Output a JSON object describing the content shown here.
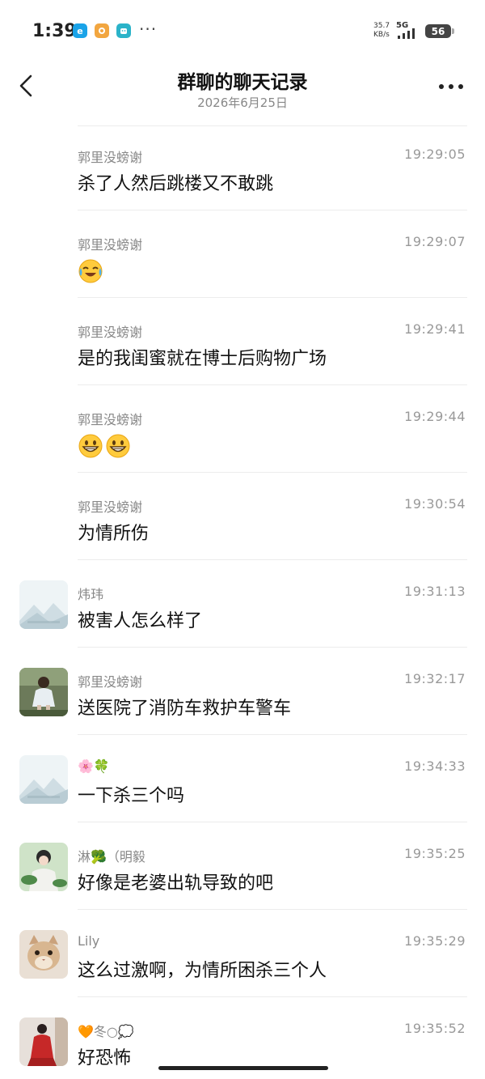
{
  "status": {
    "time": "1:39",
    "more": "···",
    "net_speed_top": "35.7",
    "net_speed_bottom": "KB/s",
    "network": "5G",
    "battery": "56"
  },
  "nav": {
    "title": "群聊的聊天记录",
    "subtitle": "2026年6月25日"
  },
  "messages": [
    {
      "sender": "郭里没螃谢",
      "time": "19:29:05",
      "text": "杀了人然后跳楼又不敢跳"
    },
    {
      "sender": "郭里没螃谢",
      "time": "19:29:07",
      "text": "",
      "emoji": [
        "tears-of-joy"
      ]
    },
    {
      "sender": "郭里没螃谢",
      "time": "19:29:41",
      "text": "是的我闺蜜就在博士后购物广场"
    },
    {
      "sender": "郭里没螃谢",
      "time": "19:29:44",
      "text": "",
      "emoji": [
        "grin",
        "grin"
      ]
    },
    {
      "sender": "郭里没螃谢",
      "time": "19:30:54",
      "text": "为情所伤"
    },
    {
      "sender": "炜玮",
      "time": "19:31:13",
      "text": "被害人怎么样了",
      "avatar": "landscape-placeholder"
    },
    {
      "sender": "郭里没螃谢",
      "time": "19:32:17",
      "text": "送医院了消防车救护车警车",
      "avatar": "girl-outdoor"
    },
    {
      "sender": "🌸🍀",
      "time": "19:34:33",
      "text": "一下杀三个吗",
      "avatar": "landscape-placeholder"
    },
    {
      "sender": "淋🥦（明毅",
      "time": "19:35:25",
      "text": "好像是老婆出轨导致的吧",
      "avatar": "girl-green"
    },
    {
      "sender": "Lily",
      "time": "19:35:29",
      "text": "这么过激啊，为情所困杀三个人",
      "avatar": "cat"
    },
    {
      "sender": "🧡冬○💭",
      "time": "19:35:52",
      "text": "好恐怖",
      "avatar": "girl-red"
    }
  ],
  "colors": {
    "divider": "#ececec",
    "secondary_text": "#888888",
    "app1": "#1aa3e8",
    "app2": "#f2a640",
    "app3": "#2bb3c9"
  }
}
